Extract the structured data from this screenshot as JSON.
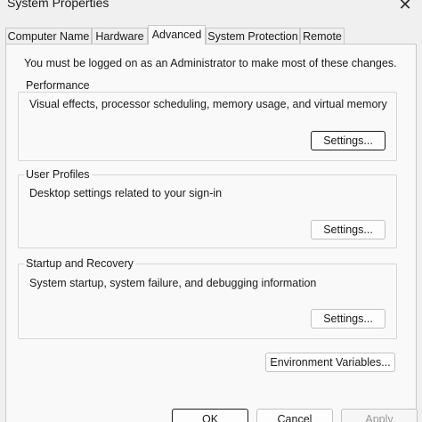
{
  "window": {
    "title": "System Properties",
    "close_glyph": "✕"
  },
  "tabs": [
    {
      "label": "Computer Name"
    },
    {
      "label": "Hardware"
    },
    {
      "label": "Advanced",
      "active": true
    },
    {
      "label": "System Protection"
    },
    {
      "label": "Remote"
    }
  ],
  "advanced": {
    "admin_note": "You must be logged on as an Administrator to make most of these changes.",
    "performance": {
      "title": "Performance",
      "description": "Visual effects, processor scheduling, memory usage, and virtual memory",
      "button": "Settings..."
    },
    "user_profiles": {
      "title": "User Profiles",
      "description": "Desktop settings related to your sign-in",
      "button": "Settings..."
    },
    "startup_recovery": {
      "title": "Startup and Recovery",
      "description": "System startup, system failure, and debugging information",
      "button": "Settings..."
    },
    "env_button": "Environment Variables..."
  },
  "footer": {
    "ok": "OK",
    "cancel": "Cancel",
    "apply": "Apply"
  },
  "colors": {
    "background": "#f0f0f0",
    "panel": "#f9f9f9",
    "focus_border": "#1a1a1a",
    "disabled_text": "#9a9a9a"
  }
}
